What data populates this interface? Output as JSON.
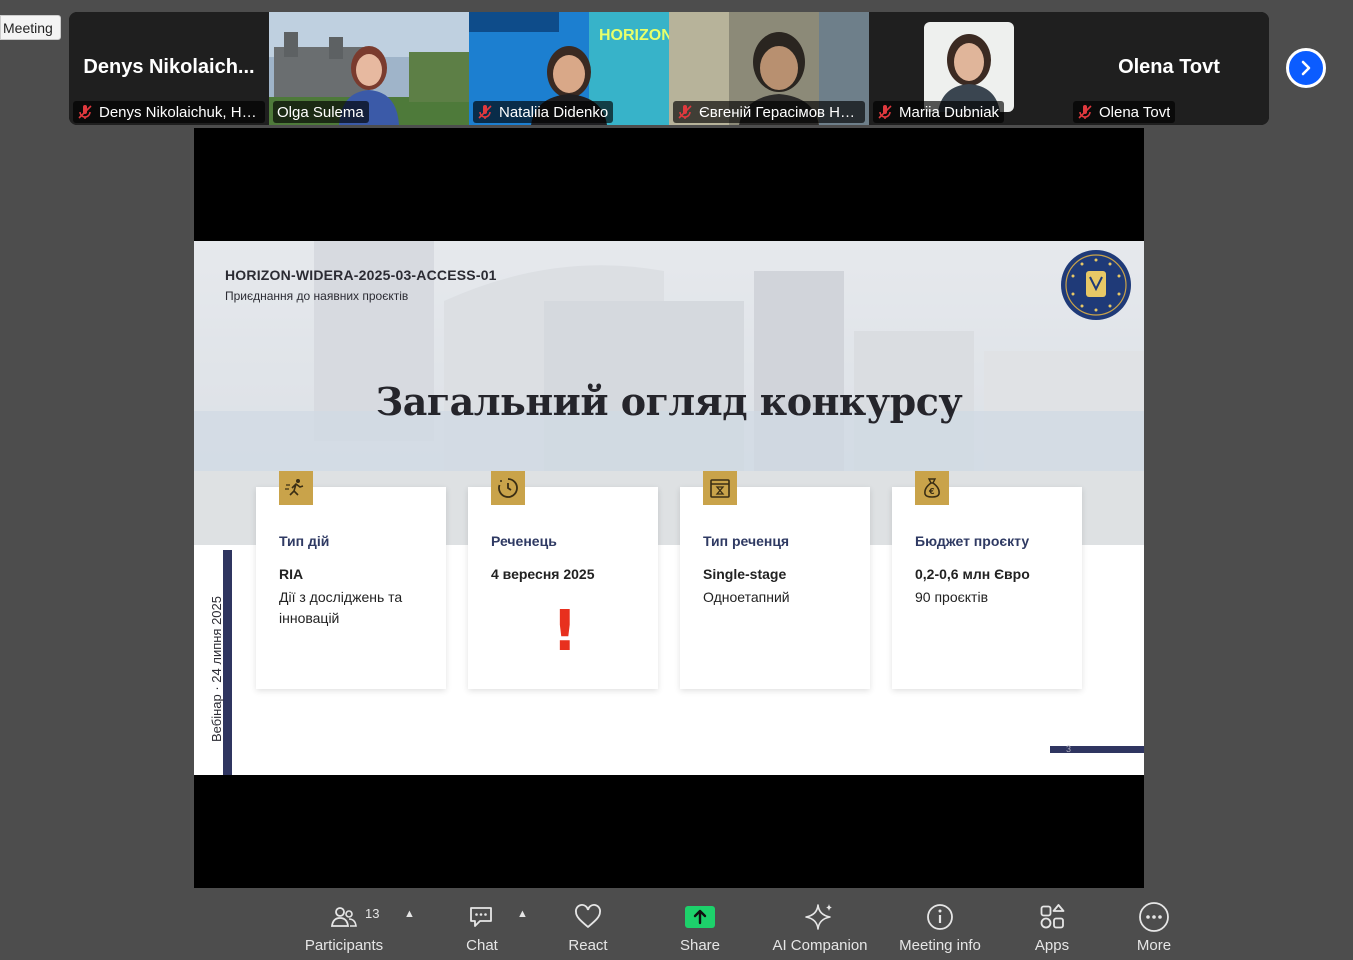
{
  "window": {
    "meeting_label": "Meeting"
  },
  "participants_strip": [
    {
      "display_name": "Denys  Nikolaich...",
      "tag": "Denys Nikolaichuk, HE...",
      "muted": true,
      "video": false
    },
    {
      "display_name": "",
      "tag": "Olga Sulema",
      "muted": false,
      "video": true,
      "active_speaker": true
    },
    {
      "display_name": "",
      "tag": "Nataliia Didenko",
      "muted": true,
      "video": true
    },
    {
      "display_name": "",
      "tag": "Євгеній Герасімов НУ...",
      "muted": true,
      "video": true
    },
    {
      "display_name": "",
      "tag": "Mariia Dubniak",
      "muted": true,
      "video": false,
      "avatar": true
    },
    {
      "display_name": "Olena Tovt",
      "tag": "Olena Tovt",
      "muted": true,
      "video": false
    }
  ],
  "nataliia_bg_text": "HORIZON EUROPE",
  "slide": {
    "code": "HORIZON-WIDERA-2025-03-ACCESS-01",
    "subtitle": "Приєднання до наявних проєктів",
    "heading": "Загальний огляд конкурсу",
    "side_text": "Вебінар · 24 липня 2025",
    "page_number": "3",
    "cards": [
      {
        "icon": "action-type-icon",
        "title": "Тип дій",
        "line1": "RIA",
        "line2": "Дії з досліджень та інновацій"
      },
      {
        "icon": "deadline-icon",
        "title": "Реченець",
        "line1": "4 вересня 2025",
        "line2": "",
        "exclamation": "!"
      },
      {
        "icon": "hourglass-calendar-icon",
        "title": "Тип реченця",
        "line1": "Single-stage",
        "line2": "Одноетапний"
      },
      {
        "icon": "money-bag-icon",
        "title": "Бюджет проєкту",
        "line1": "0,2-0,6 млн Євро",
        "line2": "90 проєктів"
      }
    ],
    "colors": {
      "accent_gold": "#c9a34a",
      "navy": "#2f3560",
      "alert_red": "#e8301e"
    }
  },
  "toolbar": {
    "participants_count": "13",
    "participants": "Participants",
    "chat": "Chat",
    "react": "React",
    "share": "Share",
    "ai_companion": "AI Companion",
    "meeting_info": "Meeting info",
    "apps": "Apps",
    "more": "More"
  },
  "colors": {
    "active_speaker_border": "#3fe07a",
    "share_green": "#1dd16b",
    "next_button": "#0b5cff",
    "mute_red": "#e0393e"
  }
}
